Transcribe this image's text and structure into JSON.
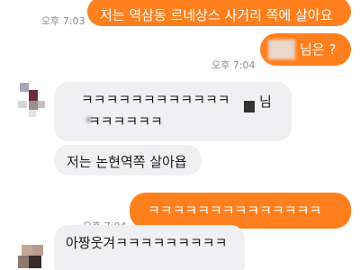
{
  "theme": {
    "outgoing_bubble": "#ff7f1e",
    "incoming_bubble": "#f0f0f3",
    "timestamp_color": "#8a8a8a"
  },
  "messages": [
    {
      "id": "m1",
      "direction": "out",
      "time": "오후 7:03",
      "text": "저는 역삼동 르네상스 사거리 쪽에 살아요"
    },
    {
      "id": "m2",
      "direction": "out",
      "time": "오후 7:04",
      "text": "님은 ?",
      "redacted_prefix": true
    },
    {
      "id": "m3",
      "direction": "in",
      "lines": [
        "ㅋㅋㅋㅋㅋㅋㅋㅋㅋㅋㅋㅋ",
        "님",
        "ㅋㅋㅋㅋㅋㅋ"
      ],
      "redacted": true
    },
    {
      "id": "m4",
      "direction": "in",
      "text": "저는 논현역쪽 살아욥"
    },
    {
      "id": "m5",
      "direction": "out",
      "time": "오후 7:04",
      "text": "ㅋㅋㅋㅋㅋㅋㅋㅋㅋㅋㅋㅋㅋㅋ"
    },
    {
      "id": "m6",
      "direction": "in",
      "text": "아짱웃겨ㅋㅋㅋㅋㅋㅋㅋㅋㅋ",
      "partial": true
    }
  ]
}
